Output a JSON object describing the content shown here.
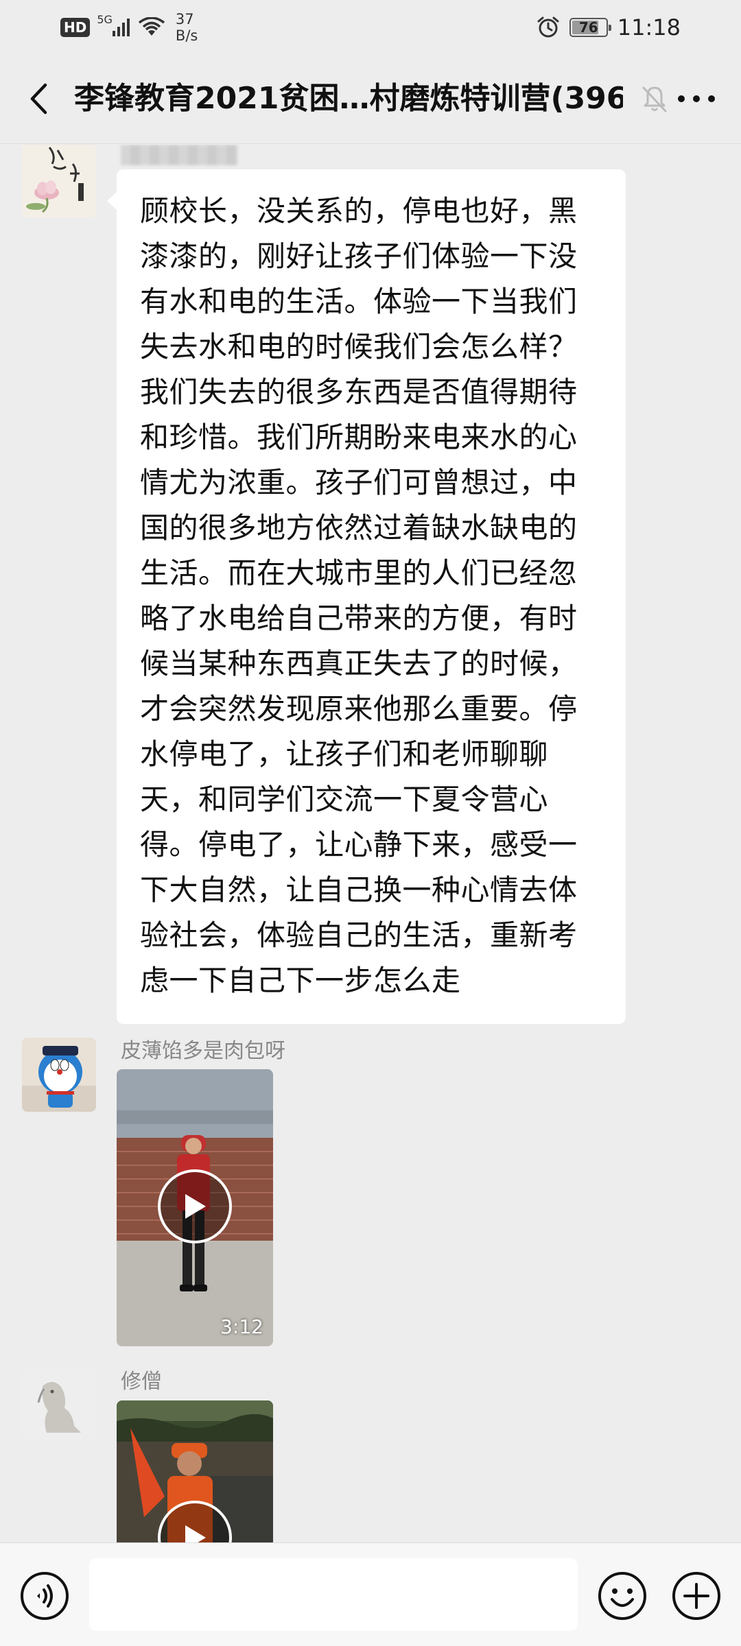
{
  "status_bar": {
    "hd": "HD",
    "network": "5G",
    "speed_value": "37",
    "speed_unit": "B/s",
    "battery": "76",
    "time": "11:18"
  },
  "header": {
    "title": "李锋教育2021贫困…村磨炼特训营(396)"
  },
  "messages": [
    {
      "type": "text",
      "text": "顾校长，没关系的，停电也好，黑漆漆的，刚好让孩子们体验一下没有水和电的生活。体验一下当我们失去水和电的时候我们会怎么样？我们失去的很多东西是否值得期待和珍惜。我们所期盼来电来水的心情尤为浓重。孩子们可曾想过，中国的很多地方依然过着缺水缺电的生活。而在大城市里的人们已经忽略了水电给自己带来的方便，有时候当某种东西真正失去了的时候，才会突然发现原来他那么重要。停水停电了，让孩子们和老师聊聊天，和同学们交流一下夏令营心得。停电了，让心静下来，感受一下大自然，让自己换一种心情去体验社会，体验自己的生活，重新考虑一下自己下一步怎么走"
    },
    {
      "type": "video",
      "sender": "皮薄馅多是肉包呀",
      "duration": "3:12"
    },
    {
      "type": "video",
      "sender": "修僧"
    }
  ]
}
